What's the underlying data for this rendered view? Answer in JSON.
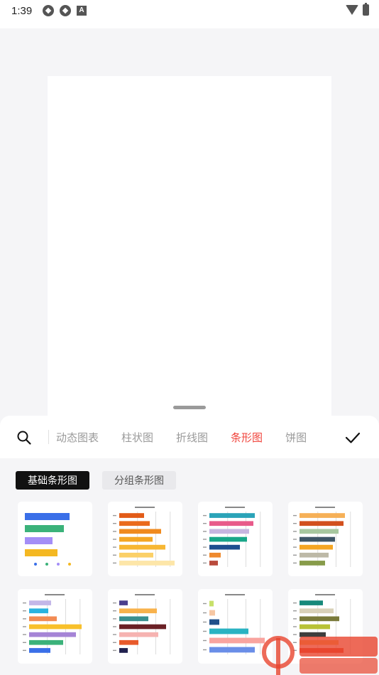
{
  "status_bar": {
    "time": "1:39"
  },
  "toolbar": {
    "tabs": [
      {
        "label": "动态图表",
        "active": false
      },
      {
        "label": "柱状图",
        "active": false
      },
      {
        "label": "折线图",
        "active": false
      },
      {
        "label": "条形图",
        "active": true
      },
      {
        "label": "饼图",
        "active": false
      }
    ],
    "active_color": "#f0433b",
    "inactive_color": "#9a9a9a"
  },
  "subtabs": [
    {
      "label": "基础条形图",
      "active": true
    },
    {
      "label": "分组条形图",
      "active": false
    }
  ],
  "templates": [
    {
      "colors": [
        "#3a6fe8",
        "#3bb27a",
        "#a48ef7",
        "#f4b822"
      ],
      "values": [
        0.9,
        0.78,
        0.55,
        0.66
      ],
      "legend": true
    },
    {
      "colors": [
        "#e25b17",
        "#ea6a1c",
        "#f08a1e",
        "#f4a623",
        "#f7b733",
        "#fbd067",
        "#fde6a8"
      ],
      "values": [
        0.45,
        0.55,
        0.75,
        0.6,
        0.83,
        0.62,
        1.0
      ],
      "legend": false
    },
    {
      "colors": [
        "#2aa3b8",
        "#e85a8a",
        "#c7b6e0",
        "#19a689",
        "#1e4f8f",
        "#ef8a2e",
        "#b94b3c"
      ],
      "values": [
        0.82,
        0.8,
        0.72,
        0.68,
        0.55,
        0.2,
        0.15
      ],
      "legend": false
    },
    {
      "colors": [
        "#f6b057",
        "#d2501e",
        "#a7c79f",
        "#3e5667",
        "#f5a623",
        "#bdb9a7",
        "#879b4a"
      ],
      "values": [
        0.82,
        0.8,
        0.7,
        0.64,
        0.6,
        0.53,
        0.46
      ],
      "legend": false
    },
    {
      "colors": [
        "#c3b7e8",
        "#2ab3e0",
        "#f28b53",
        "#f8c02b",
        "#a584d6",
        "#3bb27a",
        "#3a6fe8"
      ],
      "values": [
        0.4,
        0.35,
        0.5,
        0.95,
        0.85,
        0.62,
        0.38
      ],
      "legend": false
    },
    {
      "colors": [
        "#4b3f8c",
        "#f8b24c",
        "#3a8f8f",
        "#6a2025",
        "#f6b3b1",
        "#e85a2b",
        "#21214f"
      ],
      "values": [
        0.16,
        0.68,
        0.52,
        0.85,
        0.7,
        0.35,
        0.15
      ],
      "legend": false
    },
    {
      "colors": [
        "#c8e06a",
        "#f6c7a3",
        "#1f4f8a",
        "#2ab3c2",
        "#f9a49f",
        "#6a8ee8"
      ],
      "values": [
        0.08,
        0.1,
        0.18,
        0.7,
        1.0,
        0.82
      ],
      "legend": false
    },
    {
      "colors": [
        "#17897a",
        "#d9d1b8",
        "#7a7a3a",
        "#b8c236",
        "#3e3e3e",
        "#f5b95d",
        "#e8452e"
      ],
      "values": [
        0.42,
        0.62,
        0.72,
        0.55,
        0.48,
        0.7,
        0.8
      ],
      "legend": false
    }
  ]
}
